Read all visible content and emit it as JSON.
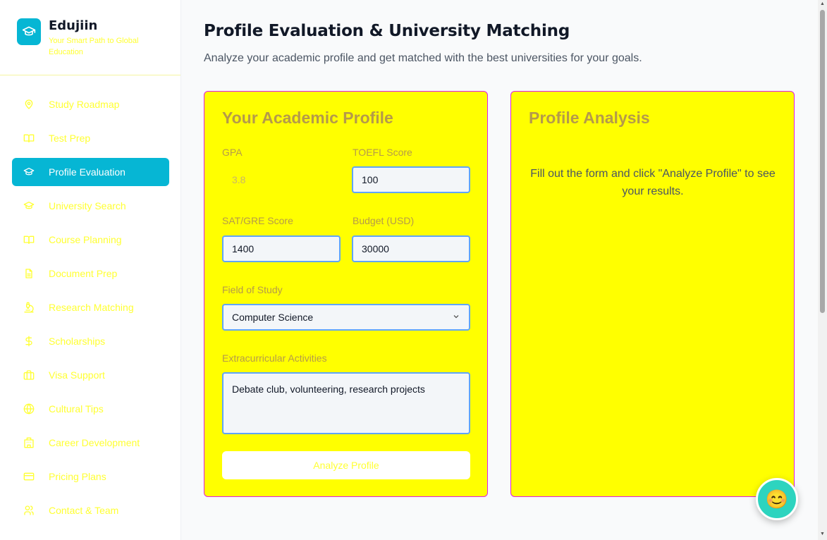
{
  "brand": {
    "name": "Edujiin",
    "tagline": "Your Smart Path to Global Education"
  },
  "sidebar": {
    "items": [
      {
        "label": "Study Roadmap",
        "icon": "map-pin-icon"
      },
      {
        "label": "Test Prep",
        "icon": "book-open-icon"
      },
      {
        "label": "Profile Evaluation",
        "icon": "graduation-cap-icon",
        "active": true
      },
      {
        "label": "University Search",
        "icon": "graduation-cap-icon"
      },
      {
        "label": "Course Planning",
        "icon": "book-open-icon"
      },
      {
        "label": "Document Prep",
        "icon": "file-text-icon"
      },
      {
        "label": "Research Matching",
        "icon": "microscope-icon"
      },
      {
        "label": "Scholarships",
        "icon": "dollar-icon"
      },
      {
        "label": "Visa Support",
        "icon": "briefcase-icon"
      },
      {
        "label": "Cultural Tips",
        "icon": "globe-icon"
      },
      {
        "label": "Career Development",
        "icon": "building-icon"
      },
      {
        "label": "Pricing Plans",
        "icon": "credit-card-icon"
      },
      {
        "label": "Contact & Team",
        "icon": "users-icon"
      }
    ]
  },
  "main": {
    "title": "Profile Evaluation & University Matching",
    "subtitle": "Analyze your academic profile and get matched with the best universities for your goals."
  },
  "form": {
    "title": "Your Academic Profile",
    "gpa_label": "GPA",
    "gpa_value": "3.8",
    "toefl_label": "TOEFL Score",
    "toefl_value": "100",
    "sat_label": "SAT/GRE Score",
    "sat_value": "1400",
    "budget_label": "Budget (USD)",
    "budget_value": "30000",
    "field_label": "Field of Study",
    "field_value": "Computer Science",
    "extra_label": "Extracurricular Activities",
    "extra_value": "Debate club, volunteering, research projects",
    "button_label": "Analyze Profile"
  },
  "analysis": {
    "title": "Profile Analysis",
    "message": "Fill out the form and click \"Analyze Profile\" to see your results."
  },
  "chat": {
    "emoji": "😊"
  },
  "colors": {
    "accent": "#06b6d4",
    "card_bg": "#ffff00",
    "card_border": "#e11de5",
    "nav_text": "#ffff33"
  }
}
